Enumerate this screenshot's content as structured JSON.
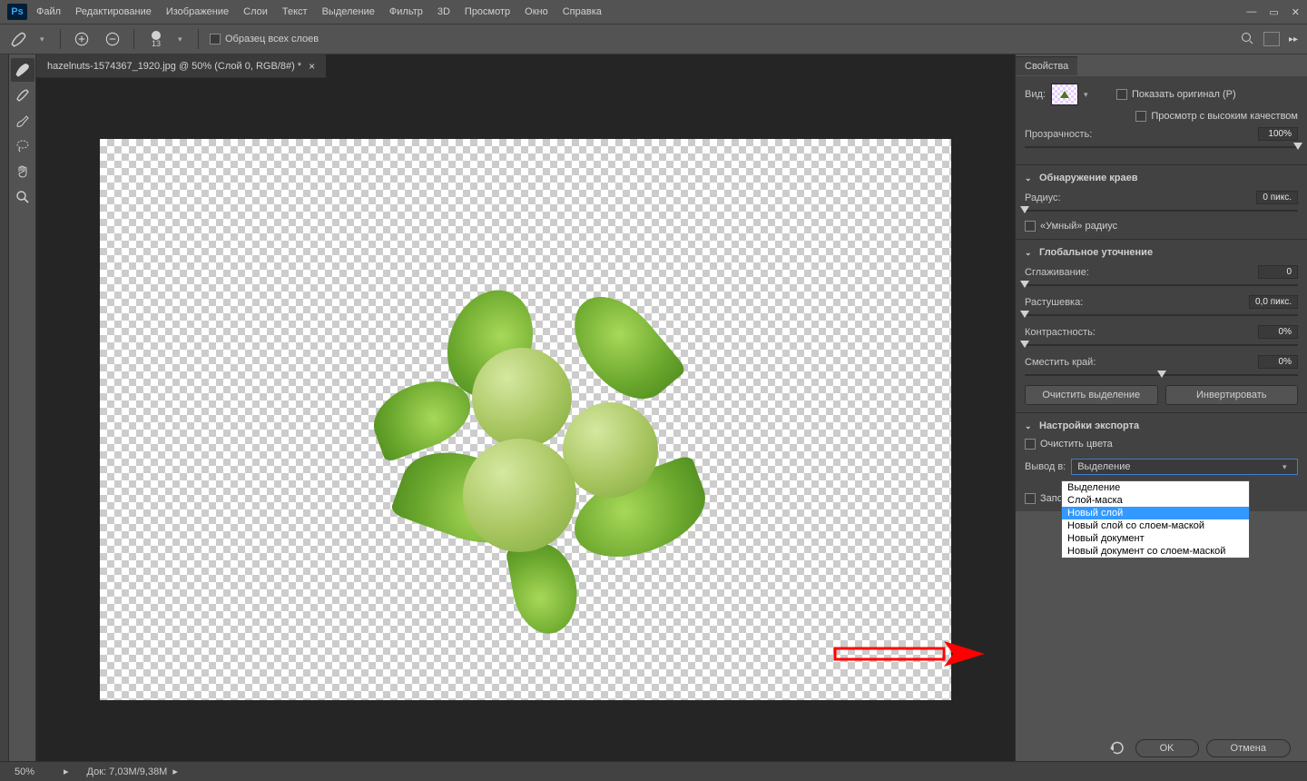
{
  "app": {
    "logo": "Ps"
  },
  "menu": [
    "Файл",
    "Редактирование",
    "Изображение",
    "Слои",
    "Текст",
    "Выделение",
    "Фильтр",
    "3D",
    "Просмотр",
    "Окно",
    "Справка"
  ],
  "optbar": {
    "brush_size": "13",
    "sample_all_label": "Образец всех слоев"
  },
  "doc_tab": {
    "title": "hazelnuts-1574367_1920.jpg @ 50% (Слой 0, RGB/8#) *"
  },
  "panels": {
    "properties_tab": "Свойства",
    "view_label": "Вид:",
    "show_original": "Показать оригинал (P)",
    "high_quality": "Просмотр с высоким качеством",
    "opacity_label": "Прозрачность:",
    "opacity_value": "100%",
    "edge_detection": {
      "title": "Обнаружение краев",
      "radius_label": "Радиус:",
      "radius_value": "0 пикс.",
      "smart_radius": "«Умный» радиус"
    },
    "global_refine": {
      "title": "Глобальное уточнение",
      "smooth_label": "Сглаживание:",
      "smooth_value": "0",
      "feather_label": "Растушевка:",
      "feather_value": "0,0 пикс.",
      "contrast_label": "Контрастность:",
      "contrast_value": "0%",
      "shift_label": "Сместить край:",
      "shift_value": "0%",
      "clear_btn": "Очистить выделение",
      "invert_btn": "Инвертировать"
    },
    "export": {
      "title": "Настройки экспорта",
      "decontaminate": "Очистить цвета",
      "output_label": "Вывод в:",
      "output_value": "Выделение",
      "remember": "Запомн",
      "dropdown": [
        "Выделение",
        "Слой-маска",
        "Новый слой",
        "Новый слой со слоем-маской",
        "Новый документ",
        "Новый документ со слоем-маской"
      ],
      "dropdown_selected_index": 2
    },
    "footer": {
      "ok": "OK",
      "cancel": "Отмена"
    }
  },
  "status": {
    "zoom": "50%",
    "doc": "Док: 7,03M/9,38M"
  }
}
